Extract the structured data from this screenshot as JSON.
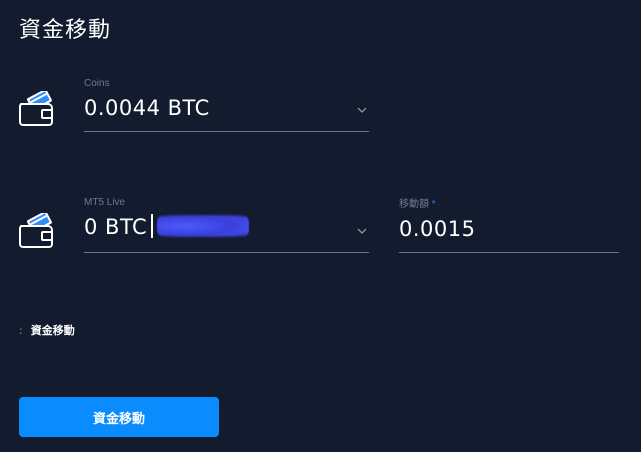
{
  "page": {
    "title": "資金移動"
  },
  "source": {
    "label": "Coins",
    "value": "0.0044 BTC",
    "icon": "wallet-icon"
  },
  "destination": {
    "label": "MT5 Live",
    "value": "0 BTC",
    "icon": "wallet-icon",
    "redacted": true
  },
  "amount": {
    "label": "移動額",
    "required_mark": "*",
    "value": "0.0015"
  },
  "summary": {
    "bullet": ":",
    "text": "資金移動"
  },
  "submit": {
    "label": "資金移動"
  },
  "colors": {
    "background": "#121c2e",
    "accent": "#0a8cff",
    "underline": "#6b7689",
    "label": "#6c7a92",
    "card": "#2f8df5"
  }
}
